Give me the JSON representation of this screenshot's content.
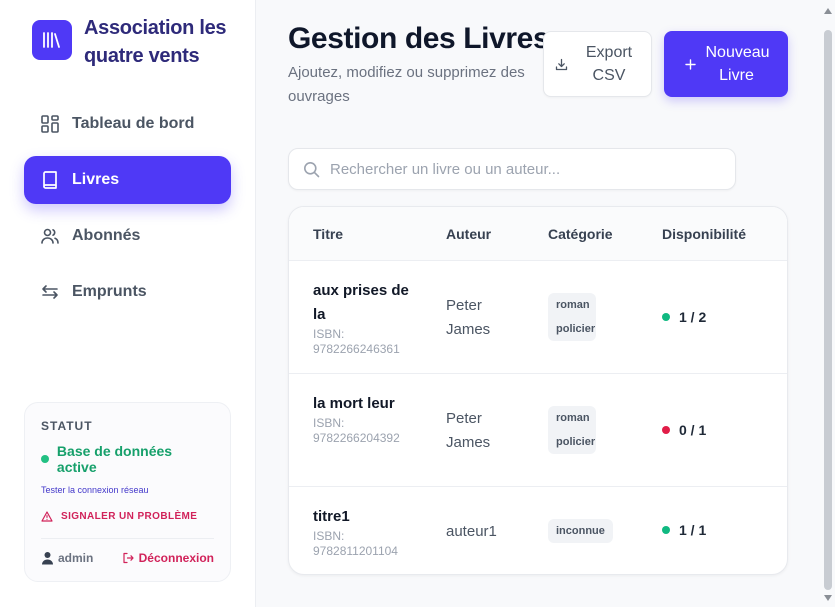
{
  "brand": {
    "name": "Association les quatre vents",
    "logo_icon": "library-icon"
  },
  "nav": {
    "items": [
      {
        "label": "Tableau de bord",
        "icon": "dashboard-icon",
        "active": false
      },
      {
        "label": "Livres",
        "icon": "book-icon",
        "active": true
      },
      {
        "label": "Abonnés",
        "icon": "users-icon",
        "active": false
      },
      {
        "label": "Emprunts",
        "icon": "swap-icon",
        "active": false
      }
    ]
  },
  "status": {
    "title": "STATUT",
    "db_label": "Base de données active",
    "test_link": "Tester la connexion réseau",
    "report_label": "SIGNALER UN PROBLÈME",
    "user": "admin",
    "logout_label": "Déconnexion"
  },
  "header": {
    "title": "Gestion des Livres",
    "subtitle": "Ajoutez, modifiez ou supprimez des ouvrages",
    "export_label": "Export CSV",
    "new_label": "Nouveau Livre"
  },
  "search": {
    "placeholder": "Rechercher un livre ou un auteur..."
  },
  "table": {
    "columns": [
      "Titre",
      "Auteur",
      "Catégorie",
      "Disponibilité"
    ],
    "rows": [
      {
        "title": "aux prises de la",
        "isbn": "ISBN: 9782266246361",
        "author": "Peter James",
        "category": "roman policier",
        "availability": "1 / 2",
        "status_color": "#10b981"
      },
      {
        "title": "la mort leur",
        "isbn": "ISBN: 9782266204392",
        "author": "Peter James",
        "category": "roman policier",
        "availability": "0 / 1",
        "status_color": "#e11d48"
      },
      {
        "title": "titre1",
        "isbn": "ISBN: 9782811201104",
        "author": "auteur1",
        "category": "inconnue",
        "availability": "1 / 1",
        "status_color": "#10b981"
      }
    ]
  },
  "colors": {
    "accent": "#4f39f6",
    "success": "#16a06b",
    "danger": "#d1225a"
  }
}
